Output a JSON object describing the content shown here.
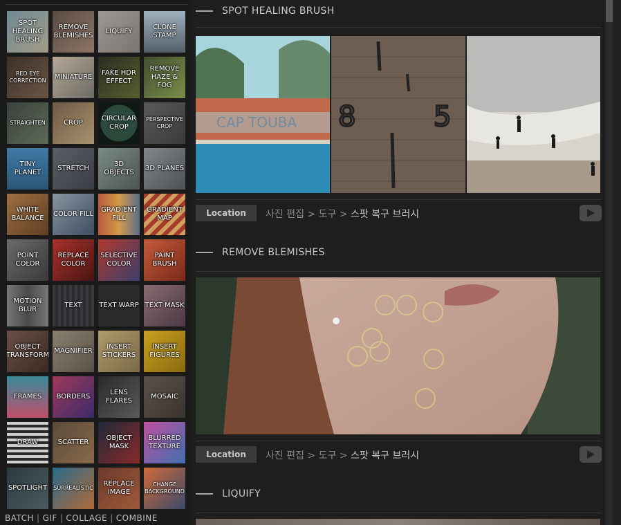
{
  "sidebar": {
    "tools": [
      {
        "label": "SPOT HEALING BRUSH",
        "bg": "linear-gradient(135deg,#6f8a94,#a29b88)",
        "small": false
      },
      {
        "label": "REMOVE BLEMISHES",
        "bg": "linear-gradient(135deg,#5a4b45,#8d7566)",
        "small": false
      },
      {
        "label": "LIQUIFY",
        "bg": "linear-gradient(135deg,#9d9893,#7a7570)",
        "small": false
      },
      {
        "label": "CLONE STAMP",
        "bg": "linear-gradient(180deg,#9fb0bd,#55606a)",
        "small": false
      },
      {
        "label": "RED EYE CORRECTION",
        "bg": "linear-gradient(135deg,#3d3028,#6a5646)",
        "small": true
      },
      {
        "label": "MINIATURE",
        "bg": "linear-gradient(135deg,#b4a898,#6c6a63)",
        "small": false
      },
      {
        "label": "FAKE HDR EFFECT",
        "bg": "linear-gradient(135deg,#2a2e20,#57602f)",
        "small": false
      },
      {
        "label": "REMOVE HAZE & FOG",
        "bg": "linear-gradient(135deg,#415030,#7b8d4a)",
        "small": false
      },
      {
        "label": "STRAIGHTEN",
        "bg": "linear-gradient(135deg,#3a3f3c,#5d6a56)",
        "small": true
      },
      {
        "label": "CROP",
        "bg": "linear-gradient(135deg,#6e5a46,#a8916e)",
        "small": false
      },
      {
        "label": "CIRCULAR CROP",
        "bg": "radial-gradient(circle,#2c4a3c 0,#2c4a3c 26px,#101814 27px)",
        "small": false
      },
      {
        "label": "PERSPECTIVE CROP",
        "bg": "linear-gradient(135deg,#5a5a5a,#3a3a3a)",
        "small": true
      },
      {
        "label": "TINY PLANET",
        "bg": "linear-gradient(180deg,#3f7aa5,#2a5676)",
        "small": false
      },
      {
        "label": "STRETCH",
        "bg": "linear-gradient(135deg,#5a6068,#3a3d42)",
        "small": false
      },
      {
        "label": "3D OBJECTS",
        "bg": "linear-gradient(135deg,#7b8a86,#4d5552)",
        "small": false
      },
      {
        "label": "3D PLANES",
        "bg": "linear-gradient(135deg,#80868b,#4e5256)",
        "small": false
      },
      {
        "label": "WHITE BALANCE",
        "bg": "linear-gradient(135deg,#a06f42,#5e3f24)",
        "small": false
      },
      {
        "label": "COLOR FILL",
        "bg": "linear-gradient(135deg,#8a94a0,#3e4d62)",
        "small": false
      },
      {
        "label": "GRADIENT FILL",
        "bg": "linear-gradient(90deg,#b85a3c,#d49a4a,#5c6e8a)",
        "small": false
      },
      {
        "label": "GRADIENT MAP",
        "bg": "repeating-linear-gradient(135deg,#a33a2a 0 6px,#d0a060 6px 12px)",
        "small": false
      },
      {
        "label": "POINT COLOR",
        "bg": "linear-gradient(135deg,#6a6a6a,#3a3a3a)",
        "small": false
      },
      {
        "label": "REPLACE COLOR",
        "bg": "linear-gradient(135deg,#a8322c,#4a1512)",
        "small": false
      },
      {
        "label": "SELECTIVE COLOR",
        "bg": "linear-gradient(135deg,#b03a30,#3b3f6a)",
        "small": false
      },
      {
        "label": "PAINT BRUSH",
        "bg": "linear-gradient(135deg,#c45a3a,#7a2a1a)",
        "small": false
      },
      {
        "label": "MOTION BLUR",
        "bg": "linear-gradient(90deg,#777,#4a4a4a,#777)",
        "small": false
      },
      {
        "label": "TEXT",
        "bg": "repeating-linear-gradient(90deg,#3a3a3e 0 4px,#2b2b2f 4px 8px)",
        "small": false
      },
      {
        "label": "TEXT WARP",
        "bg": "radial-gradient(#3a3a3a 1px,#2a2a2a 2px)",
        "small": false
      },
      {
        "label": "TEXT MASK",
        "bg": "linear-gradient(135deg,#8a6a70,#4a3a44)",
        "small": false
      },
      {
        "label": "OBJECT TRANSFORM",
        "bg": "linear-gradient(135deg,#6a5046,#3a2a24)",
        "small": false
      },
      {
        "label": "MAGNIFIER",
        "bg": "linear-gradient(135deg,#8a8070,#5a5248)",
        "small": false
      },
      {
        "label": "INSERT STICKERS",
        "bg": "linear-gradient(135deg,#b09a6a,#7a6a48)",
        "small": false
      },
      {
        "label": "INSERT FIGURES",
        "bg": "linear-gradient(135deg,#c8a020,#8a6a10)",
        "small": false
      },
      {
        "label": "FRAMES",
        "bg": "linear-gradient(180deg,#3a8a9a,#c0506a)",
        "small": false
      },
      {
        "label": "BORDERS",
        "bg": "linear-gradient(135deg,#a03a5a,#3a2a6a)",
        "small": false
      },
      {
        "label": "LENS FLARES",
        "bg": "linear-gradient(135deg,#2a2a2a,#5a5a5a)",
        "small": false
      },
      {
        "label": "MOSAIC",
        "bg": "linear-gradient(135deg,#5a524a,#3a342e)",
        "small": false
      },
      {
        "label": "DRAW",
        "bg": "repeating-linear-gradient(0deg,#cfcfcf 0 4px,#2a2a2a 4px 8px)",
        "small": false
      },
      {
        "label": "SCATTER",
        "bg": "linear-gradient(135deg,#5a4a3a,#8a6a4a)",
        "small": false
      },
      {
        "label": "OBJECT MASK",
        "bg": "linear-gradient(135deg,#1e2a3a,#8a2a2a)",
        "small": false
      },
      {
        "label": "BLURRED TEXTURE",
        "bg": "linear-gradient(135deg,#c050a0,#4070b0)",
        "small": false
      },
      {
        "label": "SPOTLIGHT",
        "bg": "linear-gradient(135deg,#2a3a40,#4a5a5e)",
        "small": false
      },
      {
        "label": "SURREALISTIC",
        "bg": "linear-gradient(135deg,#2a6a8a,#b06a3a)",
        "small": true
      },
      {
        "label": "REPLACE IMAGE",
        "bg": "linear-gradient(135deg,#6a3a2a,#a05a3a)",
        "small": false
      },
      {
        "label": "CHANGE BACKGROUND",
        "bg": "linear-gradient(135deg,#d06a3a,#3a4a6a)",
        "small": true
      }
    ],
    "bottom_links": [
      "BATCH",
      "GIF",
      "COLLAGE",
      "COMBINE"
    ]
  },
  "main": {
    "sections": [
      {
        "title": "SPOT HEALING BRUSH",
        "location_label": "Location",
        "path": [
          "사진 편집",
          "도구"
        ],
        "current": "스팟 복구 브러시"
      },
      {
        "title": "REMOVE BLEMISHES",
        "location_label": "Location",
        "path": [
          "사진 편집",
          "도구"
        ],
        "current": "스팟 복구 브러시"
      },
      {
        "title": "LIQUIFY"
      }
    ],
    "spot_image_text": {
      "sign": "CAP TOUBA",
      "num_left": "8",
      "num_right": "5"
    }
  },
  "colors": {
    "background": "#1e1e1e",
    "sidebar": "#1a1a1a",
    "button": "#3a3a3a",
    "accent_circle": "#d8c98a"
  }
}
